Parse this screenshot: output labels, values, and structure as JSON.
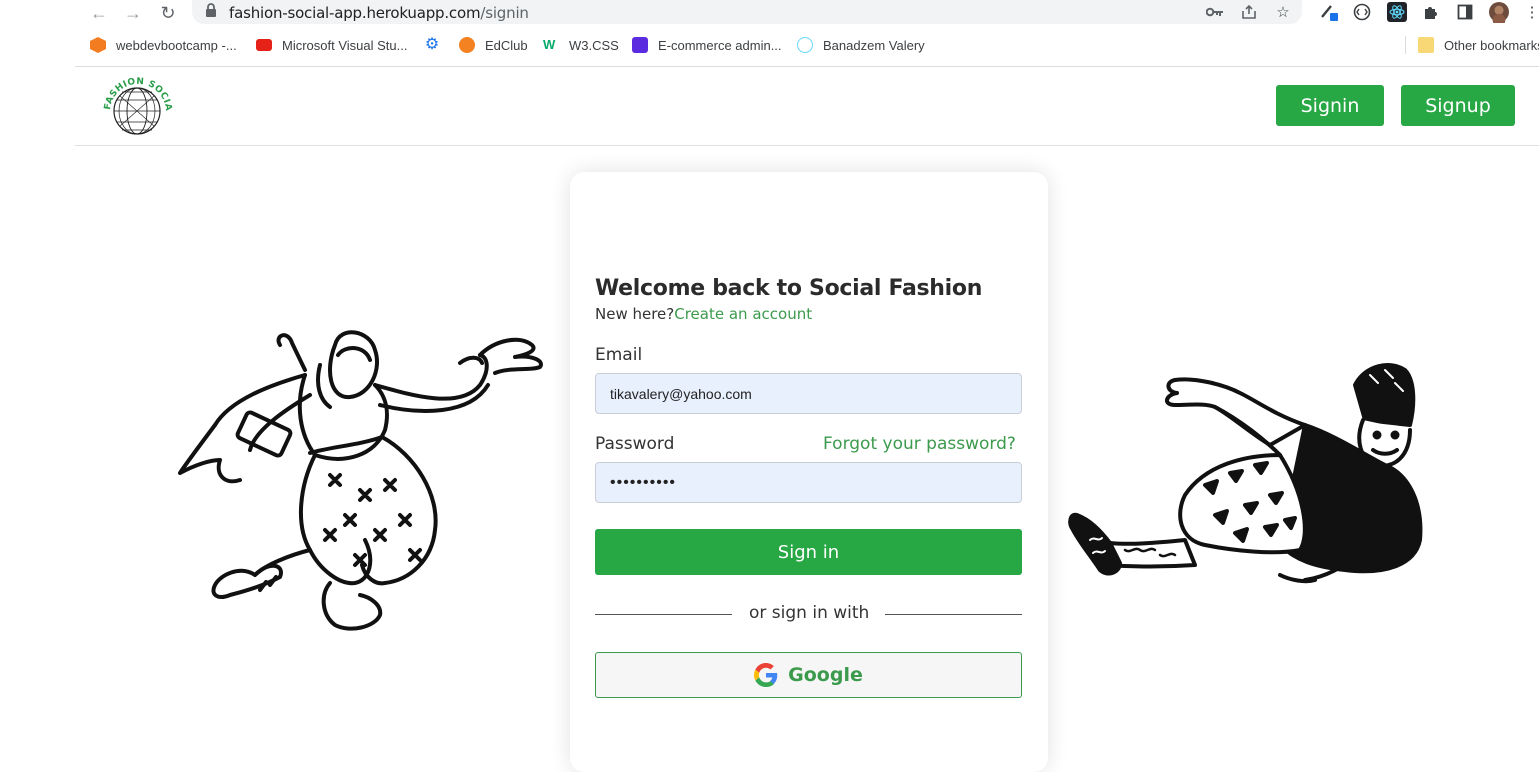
{
  "browser": {
    "url_host": "fashion-social-app.herokuapp.com",
    "url_path": "/signin",
    "bookmarks": [
      {
        "label": "webdevbootcamp -...",
        "color": "#f47c20"
      },
      {
        "label": "Microsoft Visual Stu...",
        "color": "#e62117"
      },
      {
        "label": "",
        "color": "#1a73e8"
      },
      {
        "label": "EdClub",
        "color": "#f58220"
      },
      {
        "label": "W3.CSS",
        "color": "#04aa6d"
      },
      {
        "label": "E-commerce admin...",
        "color": "#5b2be0"
      },
      {
        "label": "Banadzem Valery",
        "color": "#61dafb"
      }
    ],
    "other_bookmarks": "Other bookmarks"
  },
  "header": {
    "logo_text": "FASHION SOCIAL",
    "signin_label": "Signin",
    "signup_label": "Signup"
  },
  "form": {
    "title": "Welcome back to Social Fashion",
    "new_here": "New here?",
    "create_account": "Create an account",
    "email_label": "Email",
    "email_value": "tikavalery@yahoo.com",
    "password_label": "Password",
    "forgot_password": "Forgot your password?",
    "password_value": "••••••••••",
    "submit_label": "Sign in",
    "divider_text": "or sign in with",
    "google_label": "Google"
  },
  "colors": {
    "accent": "#28a745",
    "link": "#3c9a4d",
    "input_bg": "#e8f0fe"
  }
}
